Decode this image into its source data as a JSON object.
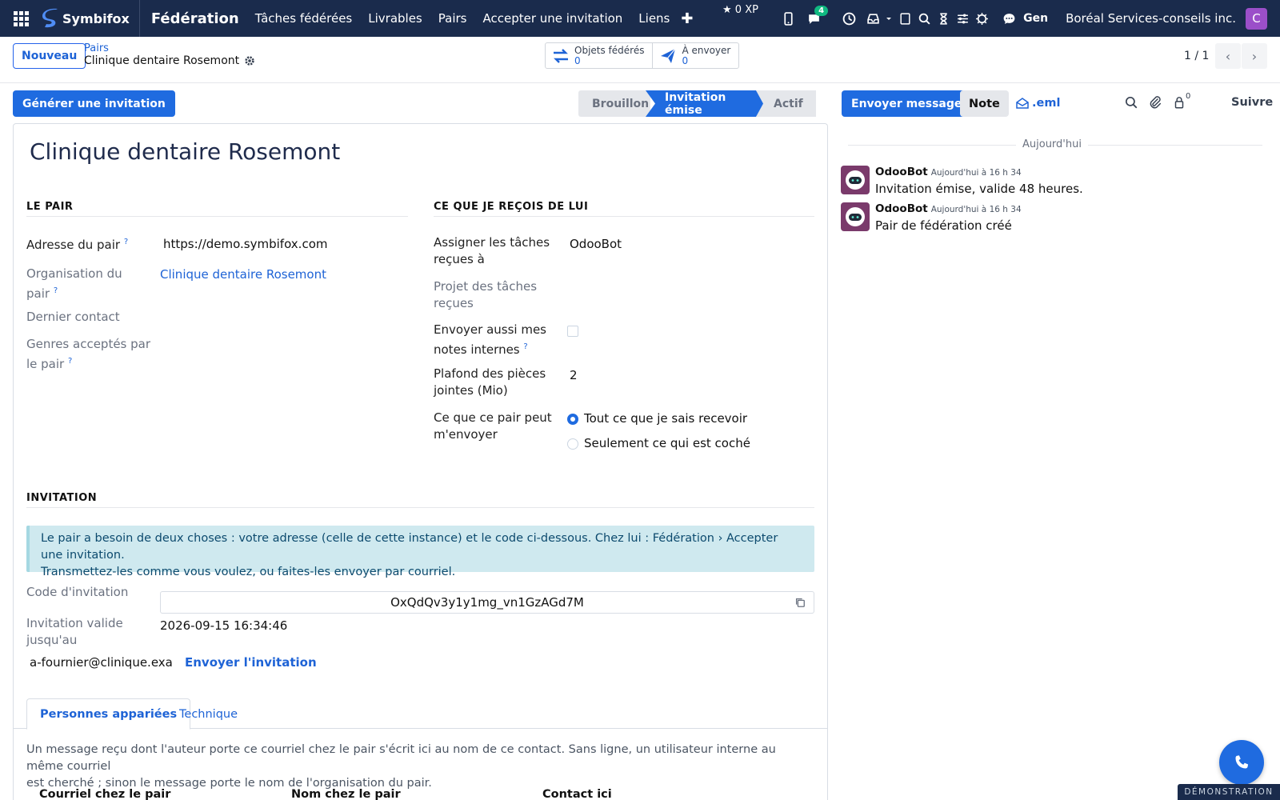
{
  "navbar": {
    "brand": "Symbifox",
    "app_title": "Fédération",
    "menu": [
      "Tâches fédérées",
      "Livrables",
      "Pairs",
      "Accepter une invitation",
      "Liens"
    ],
    "xp": "0 XP",
    "messages_badge": "4",
    "gen_label": "Gen",
    "company": "Boréal Services-conseils inc.",
    "user_initial": "C"
  },
  "control_panel": {
    "new_button": "Nouveau",
    "breadcrumb_parent": "Pairs",
    "breadcrumb_current": "Clinique dentaire Rosemont",
    "smart_buttons": [
      {
        "label": "Objets fédérés",
        "value": "0"
      },
      {
        "label": "À envoyer",
        "value": "0"
      }
    ],
    "pager": "1 / 1"
  },
  "statusbar": {
    "generate_button": "Générer une invitation",
    "stages": [
      "Brouillon",
      "Invitation émise",
      "Actif"
    ],
    "active_stage": "Invitation émise"
  },
  "form": {
    "title": "Clinique dentaire Rosemont",
    "section_peer": "LE PAIR",
    "section_receive": "CE QUE JE REÇOIS DE LUI",
    "section_invitation": "INVITATION",
    "fields_left": {
      "peer_address_label": "Adresse du pair",
      "peer_address_value": "https://demo.symbifox.com",
      "peer_org_label_1": "Organisation du",
      "peer_org_label_2": "pair",
      "peer_org_value": "Clinique dentaire Rosemont",
      "last_contact_label": "Dernier contact",
      "accepted_kinds_label_1": "Genres acceptés par",
      "accepted_kinds_label_2": "le pair"
    },
    "fields_right": {
      "assign_label_1": "Assigner les tâches",
      "assign_label_2": "reçues à",
      "assign_value": "OdooBot",
      "project_label_1": "Projet des tâches",
      "project_label_2": "reçues",
      "send_notes_label_1": "Envoyer aussi mes",
      "send_notes_label_2": "notes internes",
      "attach_limit_label_1": "Plafond des pièces",
      "attach_limit_label_2": "jointes (Mio)",
      "attach_limit_value": "2",
      "what_peer_label_1": "Ce que ce pair peut",
      "what_peer_label_2": "m'envoyer",
      "radio_all": "Tout ce que je sais recevoir",
      "radio_checked": "Seulement ce qui est coché"
    },
    "alert_line1": "Le pair a besoin de deux choses : votre adresse (celle de cette instance) et le code ci-dessous. Chez lui : Fédération › Accepter une invitation.",
    "alert_line2": "Transmettez-les comme vous voulez, ou faites-les envoyer par courriel.",
    "invite_code_label": "Code d'invitation",
    "invite_code_value": "OxQdQv3y1y1mg_vn1GzAGd7M",
    "valid_until_label_1": "Invitation valide",
    "valid_until_label_2": "jusqu'au",
    "valid_until_value": "2026-09-15 16:34:46",
    "email_value": "a-fournier@clinique.examp",
    "send_invitation": "Envoyer l'invitation",
    "tabs": [
      "Personnes appariées",
      "Technique"
    ],
    "help_line1": "Un message reçu dont l'auteur porte ce courriel chez le pair s'écrit ici au nom de ce contact. Sans ligne, un utilisateur interne au même courriel",
    "help_line2": "est cherché ; sinon le message porte le nom de l'organisation du pair.",
    "table_headers": [
      "Courriel chez le pair",
      "Nom chez le pair",
      "Contact ici"
    ]
  },
  "chatter": {
    "send_message": "Envoyer message",
    "note": "Note",
    "eml": ".eml",
    "followers_count": "0",
    "follow": "Suivre",
    "today": "Aujourd'hui",
    "messages": [
      {
        "author": "OdooBot",
        "date": "Aujourd'hui à 16 h 34",
        "body": "Invitation émise, valide 48 heures."
      },
      {
        "author": "OdooBot",
        "date": "Aujourd'hui à 16 h 34",
        "body": "Pair de fédération créé"
      }
    ]
  },
  "demo_ribbon": "DÉMONSTRATION",
  "colors": {
    "navbar": "#1a2b4c",
    "primary": "#1f6be0",
    "alert": "#cfe9ef"
  }
}
